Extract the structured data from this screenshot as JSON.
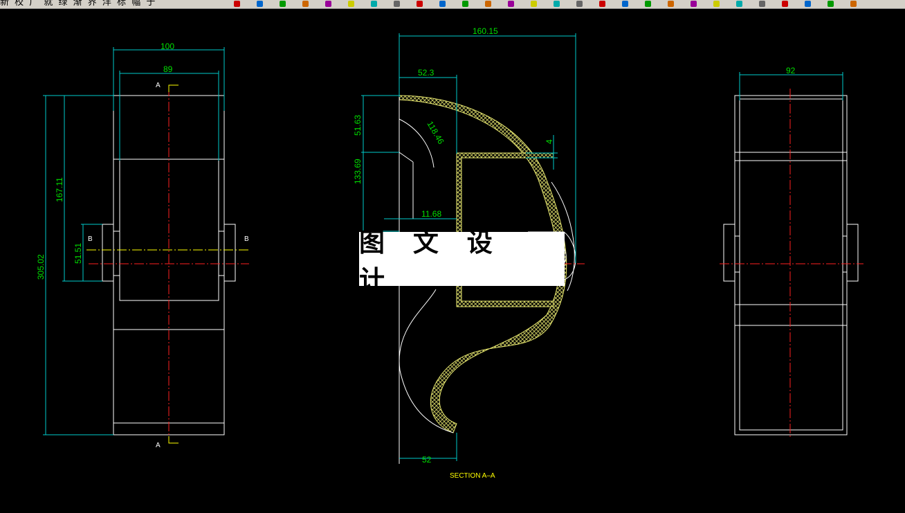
{
  "toolbar": {
    "menu_text": "新 校 广 就 绿 渐 界 洋 标 幅 于",
    "icons": [
      "pen-icon",
      "arrow-icon",
      "line-icon",
      "circle-icon",
      "layer-icon",
      "paint-icon",
      "grid-icon",
      "zoom-icon",
      "pan-icon",
      "snap-icon",
      "text-icon",
      "hatch-icon",
      "dim-icon",
      "properties-icon",
      "table-icon",
      "plus-icon",
      "minus-icon",
      "arc-icon",
      "help-icon",
      "print-icon",
      "undo-icon",
      "redo-icon",
      "color-icon",
      "select-icon",
      "mirror-icon",
      "offset-icon",
      "trim-icon",
      "close-icon"
    ]
  },
  "colors": {
    "background": "#000000",
    "geometry": "#ffffff",
    "dimension": "#00cccc",
    "dimension_text": "#00e000",
    "centerline": "#ff2020",
    "hatch": "#e8e870",
    "section_marker": "#ffff00"
  },
  "dimensions": {
    "left_width": "100",
    "left_inner_width": "89",
    "left_total_height": "305.02",
    "left_upper_height": "167.11",
    "left_hub_height": "51.51",
    "mid_width": "160.15",
    "mid_upper_width": "52.3",
    "mid_top_height": "51.63",
    "mid_radius": "118.46",
    "mid_thickness": "4",
    "mid_lower_height": "133.69",
    "mid_small": "11.68",
    "mid_bottom": "52",
    "right_width": "92"
  },
  "labels": {
    "section_a_top": "A",
    "section_a_bottom": "A",
    "section_b_left": "B",
    "section_b_right": "B",
    "section_title": "SECTION A–A"
  },
  "watermark": "图 文 设 计"
}
